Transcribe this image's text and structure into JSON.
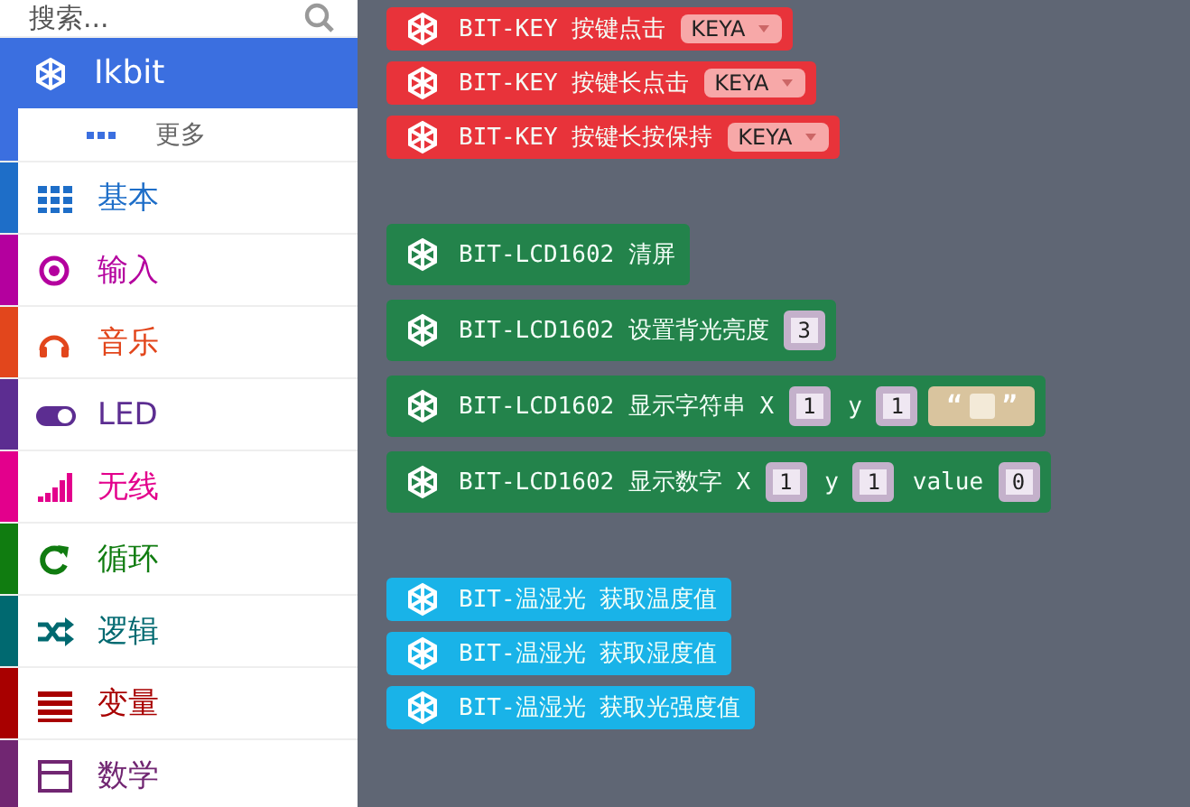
{
  "sidebar": {
    "search": {
      "placeholder": "搜索..."
    },
    "items": [
      {
        "kind": "extension",
        "label": "Ikbit",
        "selected": true,
        "color": "#3b6fe0"
      },
      {
        "kind": "more",
        "label": "更多",
        "selected": false,
        "color": "#3b6fe0"
      },
      {
        "kind": "category",
        "label": "基本",
        "selected": false,
        "color": "#1e6ec8"
      },
      {
        "kind": "category",
        "label": "输入",
        "selected": false,
        "color": "#b4009e"
      },
      {
        "kind": "category",
        "label": "音乐",
        "selected": false,
        "color": "#e2461c"
      },
      {
        "kind": "category",
        "label": "LED",
        "selected": false,
        "color": "#5c2d91"
      },
      {
        "kind": "category",
        "label": "无线",
        "selected": false,
        "color": "#e3008c"
      },
      {
        "kind": "category",
        "label": "循环",
        "selected": false,
        "color": "#107c10"
      },
      {
        "kind": "category",
        "label": "逻辑",
        "selected": false,
        "color": "#006970"
      },
      {
        "kind": "category",
        "label": "变量",
        "selected": false,
        "color": "#a80000"
      },
      {
        "kind": "category",
        "label": "数学",
        "selected": false,
        "color": "#712672"
      }
    ]
  },
  "workspace": {
    "groups": [
      {
        "kind": "key",
        "blocks": [
          {
            "segments": [
              {
                "kind": "label",
                "text": "BIT-KEY 按键点击"
              },
              {
                "kind": "dropdown",
                "text": "KEYA"
              }
            ]
          },
          {
            "segments": [
              {
                "kind": "label",
                "text": "BIT-KEY 按键长点击"
              },
              {
                "kind": "dropdown",
                "text": "KEYA"
              }
            ]
          },
          {
            "segments": [
              {
                "kind": "label",
                "text": "BIT-KEY 按键长按保持"
              },
              {
                "kind": "dropdown",
                "text": "KEYA"
              }
            ]
          }
        ]
      },
      {
        "kind": "lcd",
        "blocks": [
          {
            "segments": [
              {
                "kind": "label",
                "text": "BIT-LCD1602 清屏"
              }
            ]
          },
          {
            "segments": [
              {
                "kind": "label",
                "text": "BIT-LCD1602 设置背光亮度"
              },
              {
                "kind": "number",
                "text": "3"
              }
            ]
          },
          {
            "segments": [
              {
                "kind": "label",
                "text": "BIT-LCD1602 显示字符串 X"
              },
              {
                "kind": "number",
                "text": "1"
              },
              {
                "kind": "label",
                "text": "y"
              },
              {
                "kind": "number",
                "text": "1"
              },
              {
                "kind": "string",
                "open": "“",
                "close": "”"
              }
            ]
          },
          {
            "segments": [
              {
                "kind": "label",
                "text": "BIT-LCD1602 显示数字 X"
              },
              {
                "kind": "number",
                "text": "1"
              },
              {
                "kind": "label",
                "text": "y"
              },
              {
                "kind": "number",
                "text": "1"
              },
              {
                "kind": "label",
                "text": "value"
              },
              {
                "kind": "number",
                "text": "0"
              }
            ]
          }
        ]
      },
      {
        "kind": "sensor",
        "blocks": [
          {
            "segments": [
              {
                "kind": "label",
                "text": "BIT-温湿光 获取温度值"
              }
            ]
          },
          {
            "segments": [
              {
                "kind": "label",
                "text": "BIT-温湿光 获取湿度值"
              }
            ]
          },
          {
            "segments": [
              {
                "kind": "label",
                "text": "BIT-温湿光 获取光强度值"
              }
            ]
          }
        ]
      }
    ]
  }
}
